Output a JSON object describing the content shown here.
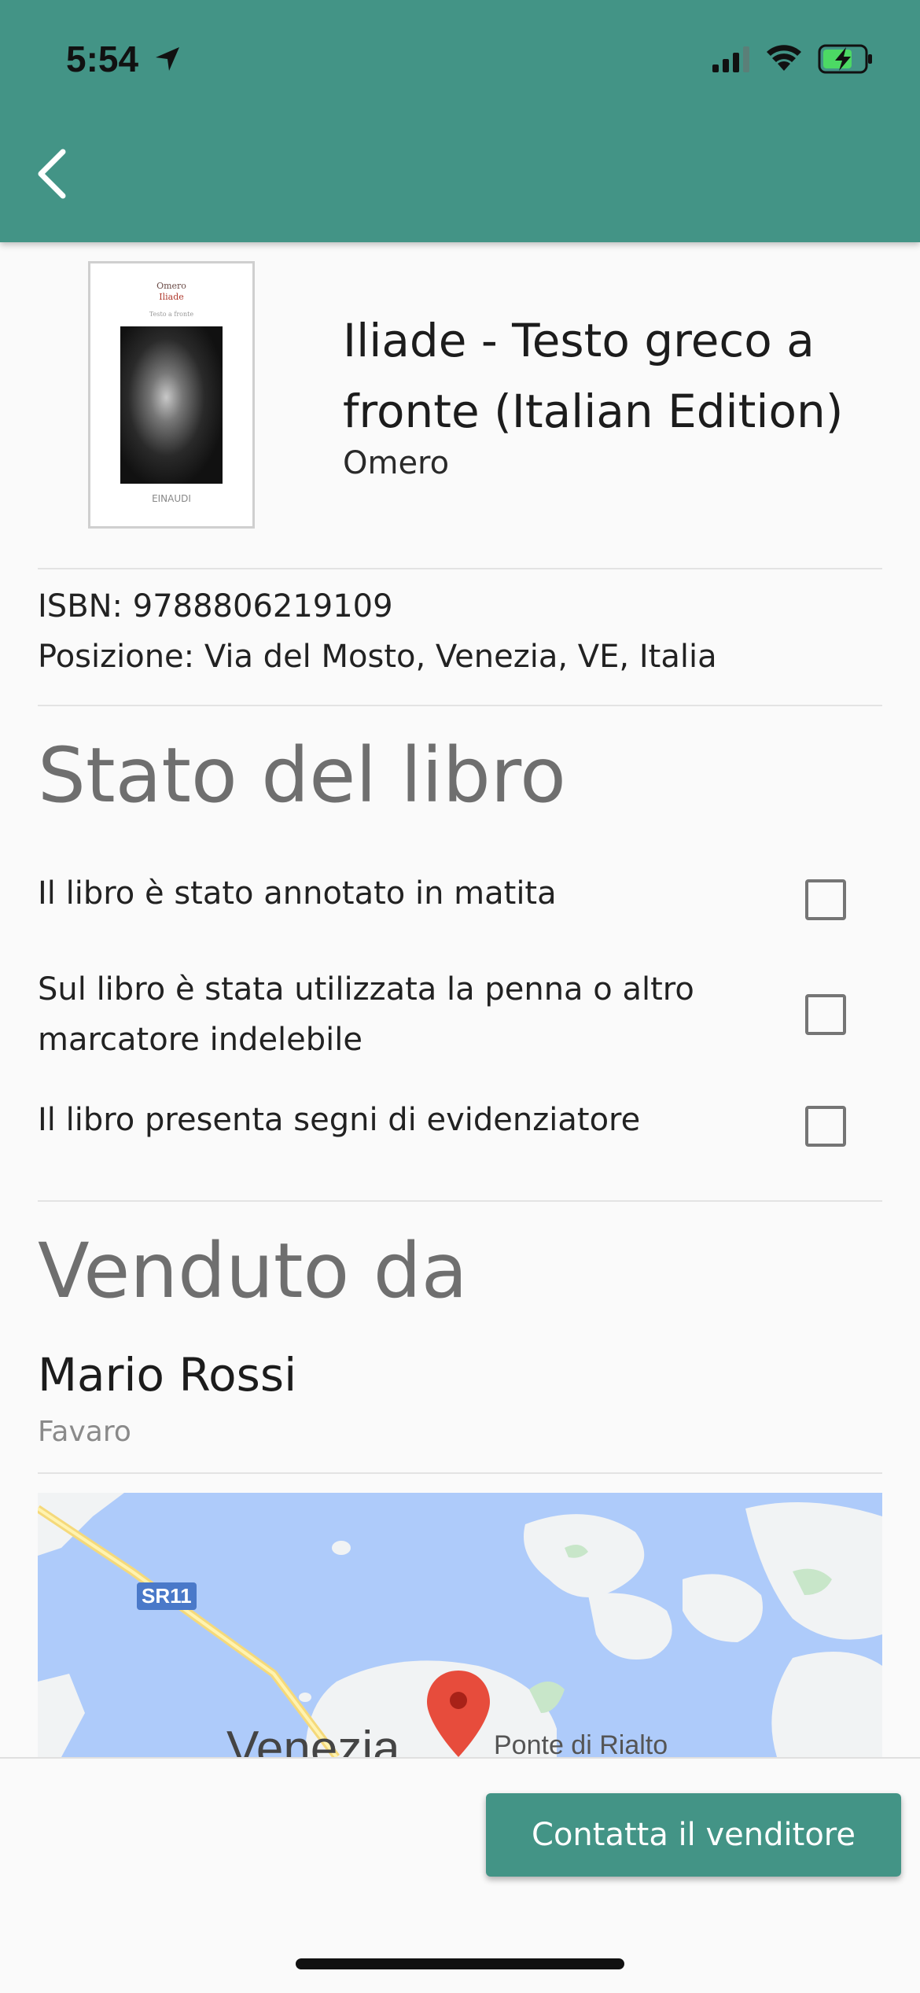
{
  "status_bar": {
    "time": "5:54"
  },
  "book": {
    "title": "Iliade - Testo greco a fronte (Italian Edition)",
    "author": "Omero",
    "cover": {
      "author": "Omero",
      "title": "Iliade",
      "subtitle": "Testo a fronte",
      "publisher": "EINAUDI"
    },
    "isbn_line": "ISBN: 9788806219109",
    "position_line": "Posizione: Via del Mosto, Venezia, VE, Italia"
  },
  "condition": {
    "title": "Stato del libro",
    "items": [
      {
        "label": "Il libro è stato annotato in matita",
        "checked": false
      },
      {
        "label": "Sul libro è stata utilizzata la penna o altro marcatore indelebile",
        "checked": false
      },
      {
        "label": "Il libro presenta segni di evidenziatore",
        "checked": false
      }
    ]
  },
  "seller": {
    "title": "Venduto da",
    "name": "Mario Rossi",
    "city": "Favaro"
  },
  "map": {
    "road_label": "SR11",
    "city_label": "Venezia",
    "poi_label": "Ponte di Rialto",
    "water_color": "#aecbfa",
    "land_color": "#f1f3f4"
  },
  "actions": {
    "contact_label": "Contatta il venditore"
  },
  "colors": {
    "accent": "#439486",
    "section_title": "#6f6f6f"
  }
}
